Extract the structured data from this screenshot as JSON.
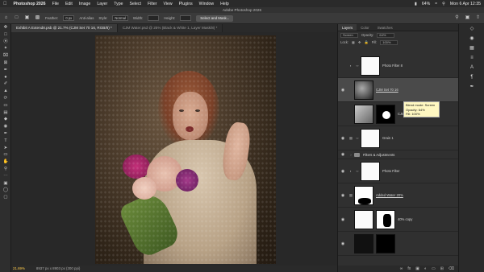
{
  "menubar": {
    "apple": "",
    "app": "Photoshop 2026",
    "items": [
      "File",
      "Edit",
      "Image",
      "Layer",
      "Type",
      "Select",
      "Filter",
      "View",
      "Plugins",
      "Window",
      "Help"
    ],
    "battery": "64%",
    "datetime": "Mon 6 Apr 12:35"
  },
  "titlebar": {
    "title": "Adobe Photoshop 2026"
  },
  "options": {
    "feather_label": "Feather:",
    "feather_value": "0 px",
    "antialias_label": "Anti-alias",
    "style_label": "Style:",
    "style_value": "Normal",
    "width_label": "Width:",
    "height_label": "Height:",
    "select_mask_label": "Select and Mask..."
  },
  "tabs": [
    {
      "label": "Exhibit A Extend8.psb @ 21.7% (CJM Set 70 16, RGB/8) *",
      "active": true
    },
    {
      "label": "CJM Water.psd @ 25% (Black & White 1, Layer Mask/8) *",
      "active": false
    }
  ],
  "status": {
    "zoom": "21.69%",
    "doc": "8937 px x 8903 px (300 ppi)"
  },
  "panel": {
    "tabs": [
      {
        "label": "Layers",
        "active": true
      },
      {
        "label": "Color",
        "active": false
      },
      {
        "label": "Swatches",
        "active": false
      }
    ],
    "blend_mode": "Screen",
    "opacity_label": "Opacity:",
    "opacity": "64%",
    "lock_label": "Lock:",
    "fill_label": "Fill:",
    "fill": "100%"
  },
  "layers": [
    {
      "name": "Photo Filter 8",
      "visible": false,
      "type": "adj"
    },
    {
      "name": "CJM Set 70 16",
      "visible": true,
      "type": "pixel",
      "selected": true
    },
    {
      "name": "CJM Set 70 12",
      "visible": false,
      "type": "pixel-mask"
    },
    {
      "name": "Grain 1",
      "visible": true,
      "type": "adj"
    },
    {
      "name": "Filters & Adjustments",
      "visible": true,
      "type": "group"
    },
    {
      "name": "Photo Filter",
      "visible": true,
      "type": "adj"
    },
    {
      "name": "Added Water 20%",
      "visible": true,
      "type": "mask"
    },
    {
      "name": "40% copy",
      "visible": true,
      "type": "mask"
    }
  ],
  "tooltip": {
    "line1": "Blend mode: Screen",
    "line2": "Opacity: 64%",
    "line3": "Fill: 100%"
  },
  "colors": {
    "accent": "#ffcb4a",
    "tooltip_bg": "#fff8c2",
    "selected_row": "#4a4a4a"
  }
}
